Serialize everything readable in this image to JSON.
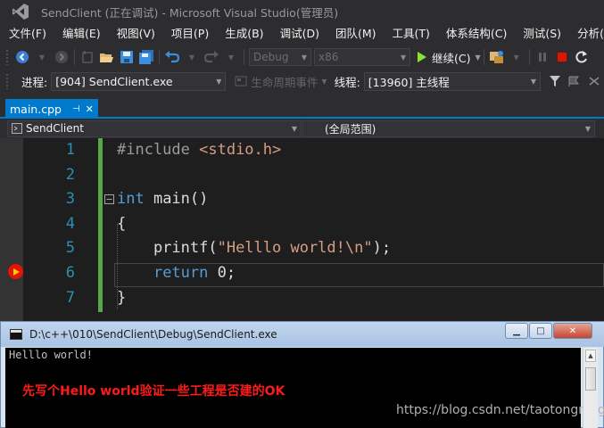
{
  "window": {
    "title": "SendClient (正在调试) - Microsoft Visual Studio(管理员)"
  },
  "menu": [
    "文件(F)",
    "编辑(E)",
    "视图(V)",
    "项目(P)",
    "生成(B)",
    "调试(D)",
    "团队(M)",
    "工具(T)",
    "体系结构(C)",
    "测试(S)",
    "分析(N)"
  ],
  "toolbar": {
    "configuration": "Debug",
    "platform": "x86",
    "continue_label": "继续(C)"
  },
  "debug_location": {
    "process_label": "进程:",
    "process_value": "[904] SendClient.exe",
    "lifecycle_label": "生命周期事件",
    "thread_label": "线程:",
    "thread_value": "[13960] 主线程"
  },
  "tab": {
    "filename": "main.cpp",
    "pin_icon": "pin-icon",
    "close_icon": "close-icon"
  },
  "navbar": {
    "scope": "SendClient",
    "member": "(全局范围)"
  },
  "editor": {
    "line_numbers": [
      "1",
      "2",
      "3",
      "4",
      "5",
      "6",
      "7"
    ],
    "current_line": 6,
    "lines": [
      {
        "n": "1",
        "parts": [
          {
            "t": "#include ",
            "c": "pp"
          },
          {
            "t": "<stdio.h>",
            "c": "str"
          }
        ]
      },
      {
        "n": "2",
        "parts": []
      },
      {
        "n": "3",
        "parts": [
          {
            "t": "int",
            "c": "kw"
          },
          {
            "t": " main()",
            "c": ""
          }
        ]
      },
      {
        "n": "4",
        "parts": [
          {
            "t": "{",
            "c": ""
          }
        ]
      },
      {
        "n": "5",
        "parts": [
          {
            "t": "    printf(",
            "c": ""
          },
          {
            "t": "\"Helllo world!\\n\"",
            "c": "str"
          },
          {
            "t": ");",
            "c": ""
          }
        ]
      },
      {
        "n": "6",
        "parts": [
          {
            "t": "    ",
            "c": ""
          },
          {
            "t": "return",
            "c": "kw"
          },
          {
            "t": " 0;",
            "c": ""
          }
        ]
      },
      {
        "n": "7",
        "parts": [
          {
            "t": "}",
            "c": ""
          }
        ]
      }
    ]
  },
  "console": {
    "title": "D:\\c++\\010\\SendClient\\Debug\\SendClient.exe",
    "output": "Helllo world!",
    "annotation": "先写个Hello world验证一些工程是否建的OK",
    "watermark": "https://blog.csdn.net/taotongning"
  },
  "colors": {
    "accent": "#007acc",
    "keyword": "#569cd6",
    "string": "#d69d85",
    "line_number": "#2b91af",
    "annotation": "#ff1a1a"
  }
}
